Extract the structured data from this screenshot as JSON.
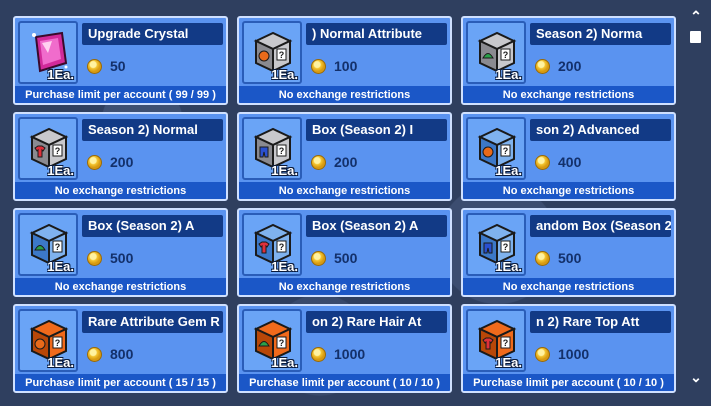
{
  "colors": {
    "card_bg": "#5a93f0",
    "name_bar": "#123a86",
    "limit_bar": "#1b57c7",
    "gray_box": "#c8c8cc",
    "blue_box": "#7fb2ee",
    "orange_box": "#f06a1c",
    "crystal": "#d12a9a"
  },
  "scroll": {
    "up_icon": "chevron-up-icon",
    "down_icon": "chevron-down-icon"
  },
  "items": [
    {
      "name": "Upgrade Crystal",
      "qty": "1Ea.",
      "price": "50",
      "limit": "Purchase limit per account ( 99 / 99 )",
      "icon": "crystal",
      "gem": ""
    },
    {
      "name": ") Normal Attribute",
      "qty": "1Ea.",
      "price": "100",
      "limit": "No exchange restrictions",
      "icon": "gray",
      "gem": "orange-ball"
    },
    {
      "name": "Season 2) Norma",
      "qty": "1Ea.",
      "price": "200",
      "limit": "No exchange restrictions",
      "icon": "gray",
      "gem": "green-cap"
    },
    {
      "name": "Season 2) Normal",
      "qty": "1Ea.",
      "price": "200",
      "limit": "No exchange restrictions",
      "icon": "gray",
      "gem": "red-shirt"
    },
    {
      "name": "Box (Season 2) I",
      "qty": "1Ea.",
      "price": "200",
      "limit": "No exchange restrictions",
      "icon": "gray",
      "gem": "blue-shorts"
    },
    {
      "name": "son 2) Advanced",
      "qty": "1Ea.",
      "price": "400",
      "limit": "No exchange restrictions",
      "icon": "blue",
      "gem": "orange-ball"
    },
    {
      "name": "Box (Season 2) A",
      "qty": "1Ea.",
      "price": "500",
      "limit": "No exchange restrictions",
      "icon": "blue",
      "gem": "green-cap"
    },
    {
      "name": "Box (Season 2) A",
      "qty": "1Ea.",
      "price": "500",
      "limit": "No exchange restrictions",
      "icon": "blue",
      "gem": "red-shirt"
    },
    {
      "name": "andom Box (Season 2",
      "qty": "1Ea.",
      "price": "500",
      "limit": "No exchange restrictions",
      "icon": "blue",
      "gem": "blue-shorts"
    },
    {
      "name": "Rare Attribute Gem R",
      "qty": "1Ea.",
      "price": "800",
      "limit": "Purchase limit per account ( 15 / 15 )",
      "icon": "orange",
      "gem": "orange-ball"
    },
    {
      "name": "on 2) Rare Hair At",
      "qty": "1Ea.",
      "price": "1000",
      "limit": "Purchase limit per account ( 10 / 10 )",
      "icon": "orange",
      "gem": "green-cap"
    },
    {
      "name": "n 2) Rare Top Att",
      "qty": "1Ea.",
      "price": "1000",
      "limit": "Purchase limit per account ( 10 / 10 )",
      "icon": "orange",
      "gem": "red-shirt"
    }
  ]
}
